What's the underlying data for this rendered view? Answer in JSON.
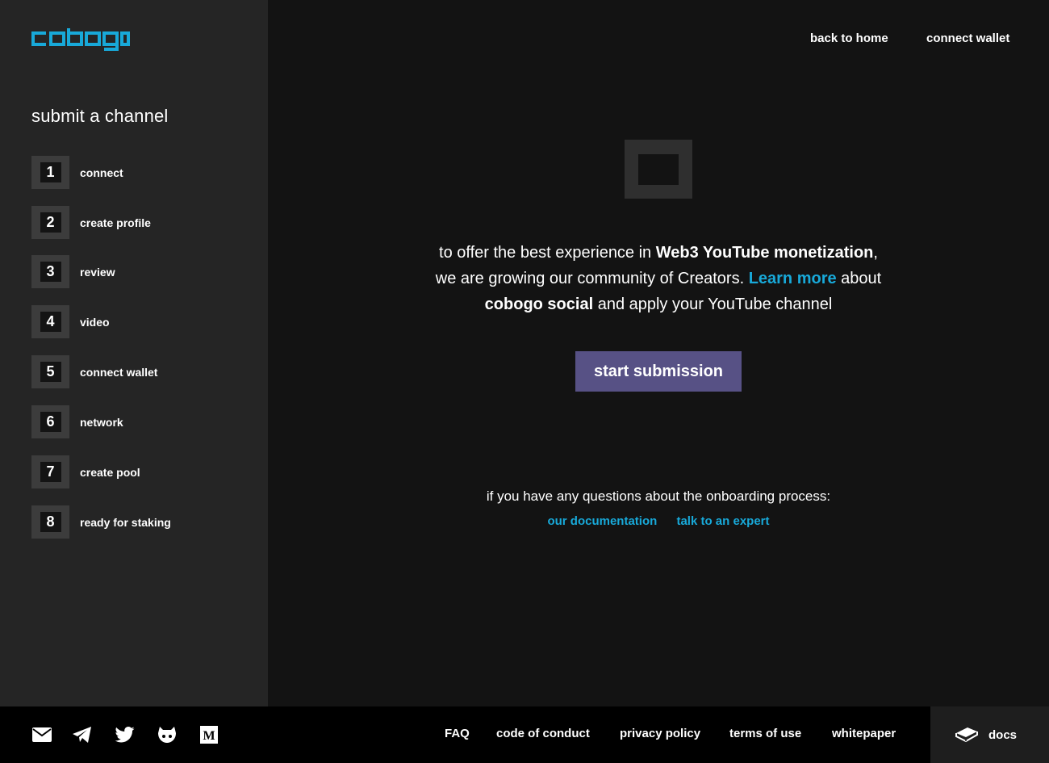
{
  "brand": {
    "name": "cobogo",
    "accent": "#18a9d9"
  },
  "header": {
    "back_home": "back to home",
    "connect_wallet": "connect wallet"
  },
  "sidebar": {
    "title": "submit a channel",
    "steps": [
      {
        "num": "1",
        "label": "connect"
      },
      {
        "num": "2",
        "label": "create profile"
      },
      {
        "num": "3",
        "label": "review"
      },
      {
        "num": "4",
        "label": "video"
      },
      {
        "num": "5",
        "label": "connect wallet"
      },
      {
        "num": "6",
        "label": "network"
      },
      {
        "num": "7",
        "label": "create pool"
      },
      {
        "num": "8",
        "label": "ready for staking"
      }
    ]
  },
  "main": {
    "text_1": "to offer the best experience in ",
    "text_bold_1": "Web3 YouTube monetization",
    "text_2": ",",
    "text_3": "we are growing our community of Creators. ",
    "learn_more": "Learn more",
    "text_4": " about",
    "text_bold_2": "cobogo social",
    "text_5": " and apply your YouTube channel",
    "start_button": "start submission",
    "questions": "if you have any questions about the onboarding process:",
    "doc_link": "our documentation",
    "expert_link": "talk to an expert",
    "button_color": "#575185"
  },
  "footer": {
    "social_icons": [
      "email-icon",
      "telegram-icon",
      "twitter-icon",
      "github-icon",
      "medium-icon"
    ],
    "links": {
      "faq": "FAQ",
      "conduct": "code of conduct",
      "privacy": "privacy policy",
      "terms": "terms of use",
      "whitepaper": "whitepaper"
    },
    "docs": "docs"
  }
}
